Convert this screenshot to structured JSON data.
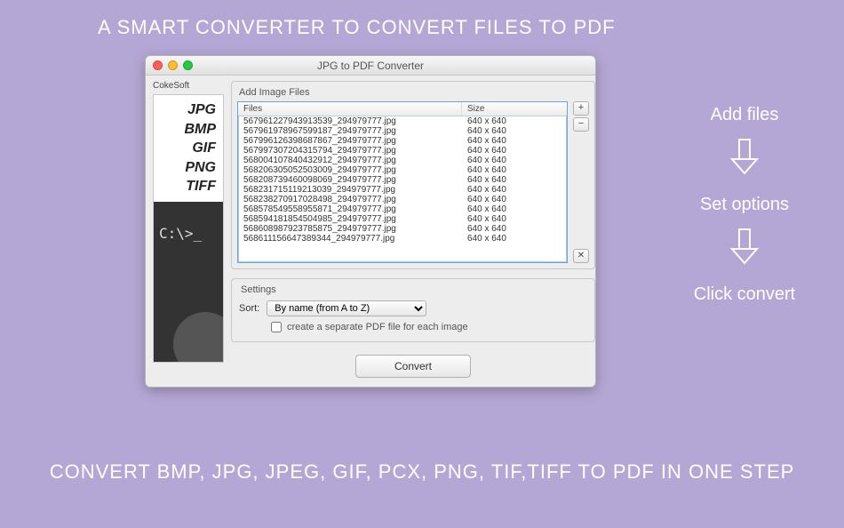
{
  "headings": {
    "top": "A SMART CONVERTER TO CONVERT FILES TO PDF",
    "bottom": "CONVERT BMP, JPG, JPEG, GIF, PCX, PNG, TIF,TIFF TO PDF IN ONE STEP"
  },
  "steps": {
    "add": "Add files",
    "set": "Set options",
    "click": "Click convert"
  },
  "window": {
    "title": "JPG to PDF Converter",
    "sidebar_label": "CokeSoft",
    "formats": [
      "JPG",
      "BMP",
      "GIF",
      "PNG",
      "TIFF"
    ],
    "side_code": "C:\\>_",
    "files_group_label": "Add Image Files",
    "settings_group_label": "Settings",
    "th_files": "Files",
    "th_size": "Size",
    "add_btn": "+",
    "remove_btn": "−",
    "clear_btn": "✕",
    "sort_label": "Sort:",
    "sort_value": "By name (from A to Z)",
    "checkbox_label": "create a separate PDF file for each image",
    "convert_label": "Convert",
    "rows": [
      {
        "name": "567961227943913539_294979777.jpg",
        "size": "640 x 640"
      },
      {
        "name": "567961978967599187_294979777.jpg",
        "size": "640 x 640"
      },
      {
        "name": "567996126398687867_294979777.jpg",
        "size": "640 x 640"
      },
      {
        "name": "567997307204315794_294979777.jpg",
        "size": "640 x 640"
      },
      {
        "name": "568004107840432912_294979777.jpg",
        "size": "640 x 640"
      },
      {
        "name": "568206305052503009_294979777.jpg",
        "size": "640 x 640"
      },
      {
        "name": "568208739460098069_294979777.jpg",
        "size": "640 x 640"
      },
      {
        "name": "568231715119213039_294979777.jpg",
        "size": "640 x 640"
      },
      {
        "name": "568238270917028498_294979777.jpg",
        "size": "640 x 640"
      },
      {
        "name": "568578549558955871_294979777.jpg",
        "size": "640 x 640"
      },
      {
        "name": "568594181854504985_294979777.jpg",
        "size": "640 x 640"
      },
      {
        "name": "568608987923785875_294979777.jpg",
        "size": "640 x 640"
      },
      {
        "name": "568611156647389344_294979777.jpg",
        "size": "640 x 640"
      }
    ]
  }
}
